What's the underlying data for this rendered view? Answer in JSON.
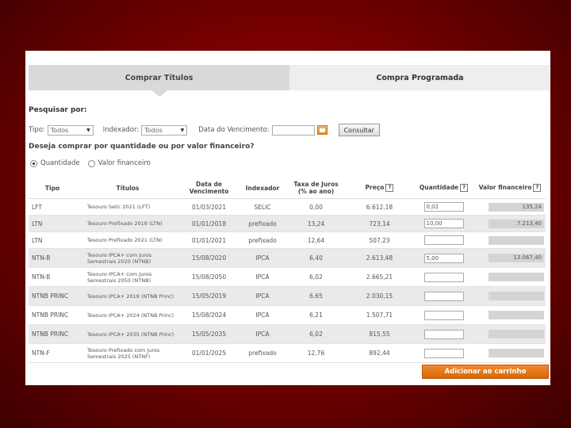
{
  "tabs": [
    {
      "label": "Comprar Títulos"
    },
    {
      "label": "Compra Programada"
    }
  ],
  "search": {
    "title": "Pesquisar por:",
    "tipo_label": "Tipo:",
    "tipo_value": "Todos",
    "indexador_label": "Indexador:",
    "indexador_value": "Todos",
    "vencimento_label": "Data do Vencimento:",
    "vencimento_value": "",
    "consultar_label": "Consultar"
  },
  "purchase_mode": {
    "question": "Deseja comprar por quantidade ou por valor financeiro?",
    "option_quantidade": "Quantidade",
    "option_valor": "Valor financeiro"
  },
  "table": {
    "headers": {
      "tipo": "Tipo",
      "titulos": "Títulos",
      "data_line1": "Data de",
      "data_line2": "Vencimento",
      "indexador": "Indexador",
      "taxa_line1": "Taxa de Juros",
      "taxa_line2": "(% ao ano)",
      "preco": "Preço",
      "quantidade": "Quantidade",
      "valor": "Valor financeiro"
    },
    "rows": [
      {
        "tipo": "LFT",
        "titulo": "Tesouro Selic 2021 (LFT)",
        "data": "01/03/2021",
        "indexador": "SELIC",
        "taxa": "0,00",
        "preco": "6.612,18",
        "qtd": "0,02",
        "valor": "135,24"
      },
      {
        "tipo": "LTN",
        "titulo": "Tesouro Prefixado 2018 (LTN)",
        "data": "01/01/2018",
        "indexador": "prefixado",
        "taxa": "13,24",
        "preco": "723,14",
        "qtd": "10,00",
        "valor": "7.213,40"
      },
      {
        "tipo": "LTN",
        "titulo": "Tesouro Prefixado 2021 (LTN)",
        "data": "01/01/2021",
        "indexador": "prefixado",
        "taxa": "12,64",
        "preco": "507,23",
        "qtd": "",
        "valor": ""
      },
      {
        "tipo": "NTN-B",
        "titulo": "Tesouro IPCA+ com Juros Semestrais 2020 (NTNB)",
        "data": "15/08/2020",
        "indexador": "IPCA",
        "taxa": "6,40",
        "preco": "2.613,48",
        "qtd": "5,00",
        "valor": "13.067,40"
      },
      {
        "tipo": "NTN-B",
        "titulo": "Tesouro IPCA+ com Juros Semestrais 2050 (NTNB)",
        "data": "15/08/2050",
        "indexador": "IPCA",
        "taxa": "6,02",
        "preco": "2.665,21",
        "qtd": "",
        "valor": ""
      },
      {
        "tipo": "NTNB PRINC",
        "titulo": "Tesouro IPCA+ 2019 (NTNB Princ)",
        "data": "15/05/2019",
        "indexador": "IPCA",
        "taxa": "6,65",
        "preco": "2.030,15",
        "qtd": "",
        "valor": ""
      },
      {
        "tipo": "NTNB PRINC",
        "titulo": "Tesouro IPCA+ 2024 (NTNB Princ)",
        "data": "15/08/2024",
        "indexador": "IPCA",
        "taxa": "6,21",
        "preco": "1.507,71",
        "qtd": "",
        "valor": ""
      },
      {
        "tipo": "NTNB PRINC",
        "titulo": "Tesouro IPCA+ 2035 (NTNB Princ)",
        "data": "15/05/2035",
        "indexador": "IPCA",
        "taxa": "6,02",
        "preco": "815,55",
        "qtd": "",
        "valor": ""
      },
      {
        "tipo": "NTN-F",
        "titulo": "Tesouro Prefixado com Juros Semestrais 2025 (NTNF)",
        "data": "01/01/2025",
        "indexador": "prefixado",
        "taxa": "12,76",
        "preco": "892,44",
        "qtd": "",
        "valor": ""
      }
    ]
  },
  "actions": {
    "add_to_cart": "Adicionar ao carrinho"
  },
  "colors": {
    "accent": "#e07a1c",
    "background": "#8b0000"
  }
}
